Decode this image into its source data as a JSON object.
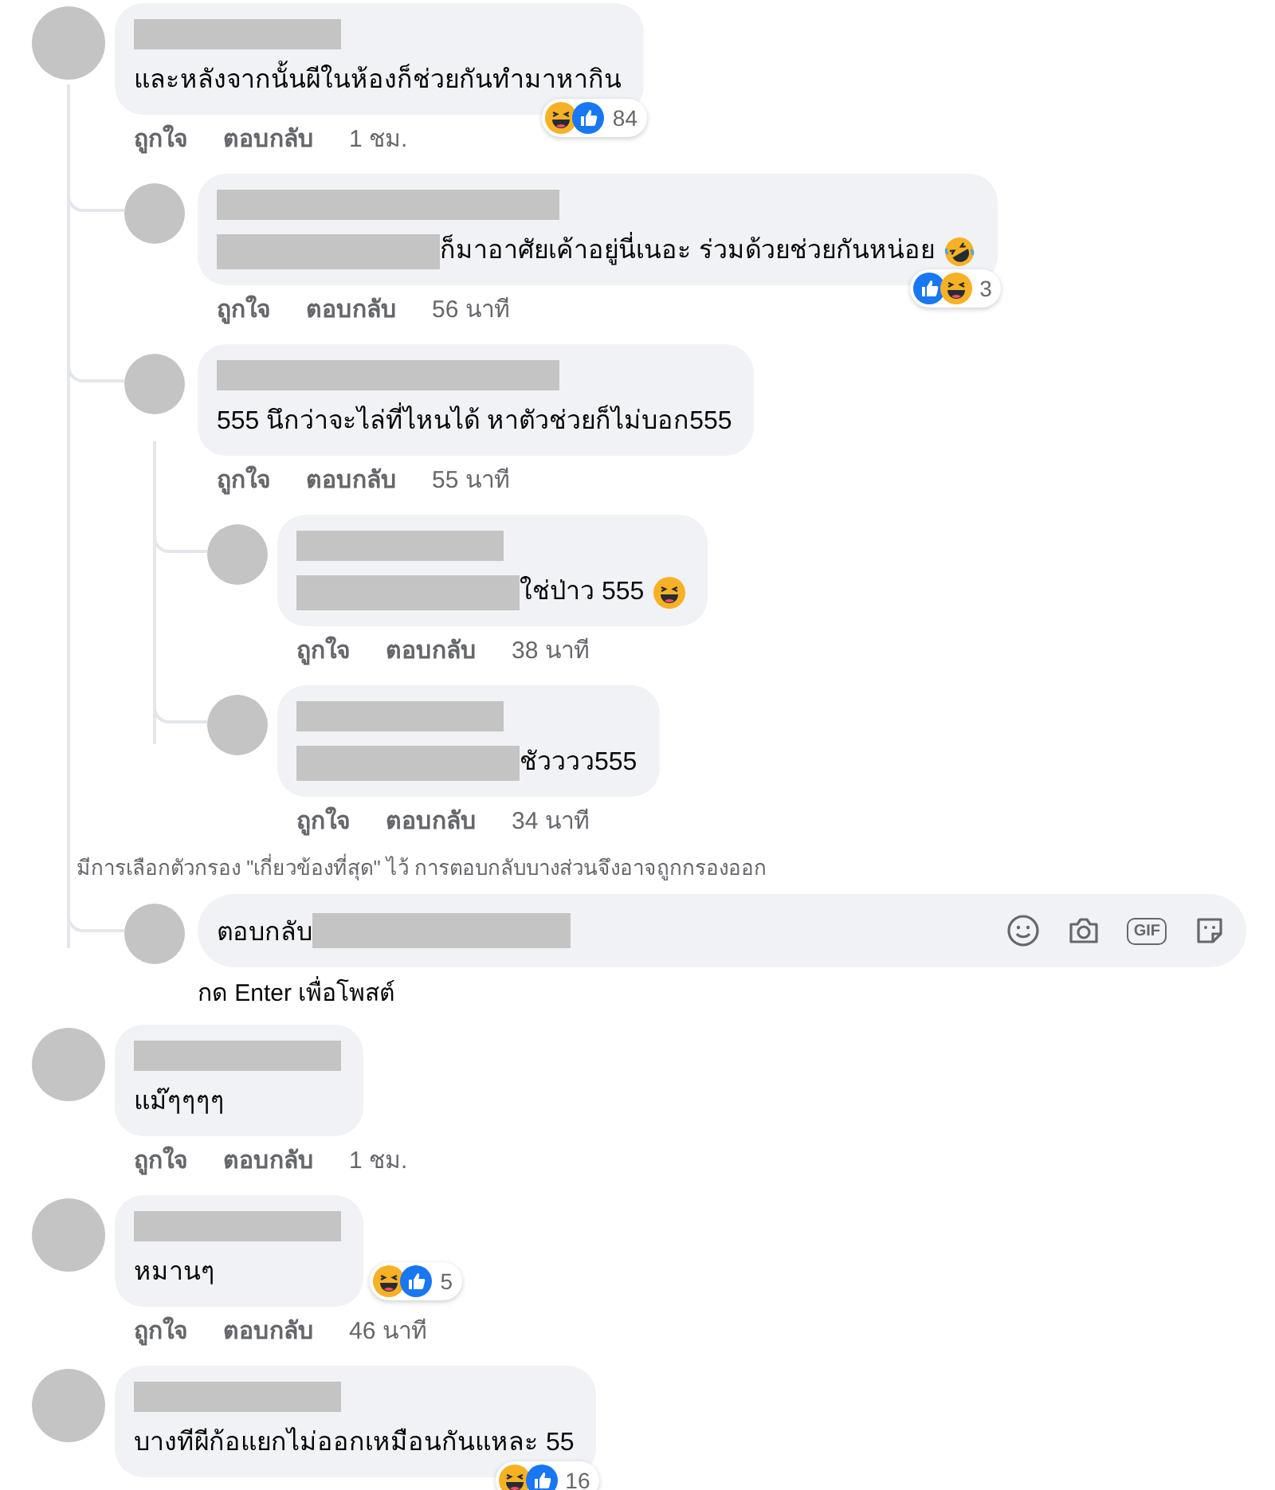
{
  "comments": [
    {
      "text": "และหลังจากนั้นผีในห้องก็ช่วยกันทำมาหากิน",
      "reactions": {
        "icons": [
          {
            "kind": "haha"
          },
          {
            "kind": "like"
          }
        ],
        "count": "84"
      },
      "like": "ถูกใจ",
      "reply": "ตอบกลับ",
      "time": "1 ชม.",
      "replies": [
        {
          "text": "ก็มาอาศัยเค้าอยู่นี่เนอะ ร่วมด้วยช่วยกันหน่อย",
          "mention": true,
          "emoji": {
            "kind": "rofl"
          },
          "reactions": {
            "icons": [
              {
                "kind": "like"
              },
              {
                "kind": "haha"
              }
            ],
            "count": "3"
          },
          "like": "ถูกใจ",
          "reply": "ตอบกลับ",
          "time": "56 นาที"
        },
        {
          "text": "555 นึกว่าจะไล่ที่ไหนได้ หาตัวช่วยก็ไม่บอก555",
          "like": "ถูกใจ",
          "reply": "ตอบกลับ",
          "time": "55 นาที",
          "replies": [
            {
              "text": "ใช่ป่าว 555",
              "mention": true,
              "emoji": {
                "kind": "haha"
              },
              "like": "ถูกใจ",
              "reply": "ตอบกลับ",
              "time": "38 นาที"
            },
            {
              "text": "ชัวววว555",
              "mention": true,
              "like": "ถูกใจ",
              "reply": "ตอบกลับ",
              "time": "34 นาที"
            }
          ]
        }
      ],
      "filter_note": "มีการเลือกตัวกรอง \"เกี่ยวข้องที่สุด\" ไว้ การตอบกลับบางส่วนจึงอาจถูกกรองออก",
      "reply_box": {
        "value": "ตอบกลับ",
        "gif_label": "GIF",
        "hint": "กด Enter เพื่อโพสต์"
      }
    },
    {
      "text": "แม๊ๆๆๆๆ",
      "like": "ถูกใจ",
      "reply": "ตอบกลับ",
      "time": "1 ชม."
    },
    {
      "text": "หมานๆ",
      "reactions": {
        "icons": [
          {
            "kind": "haha"
          },
          {
            "kind": "like"
          }
        ],
        "count": "5"
      },
      "like": "ถูกใจ",
      "reply": "ตอบกลับ",
      "time": "46 นาที"
    },
    {
      "text": "บางทีผีก้อแยกไม่ออกเหมือนกันแหละ 55",
      "reactions": {
        "icons": [
          {
            "kind": "haha"
          },
          {
            "kind": "like"
          }
        ],
        "count": "16"
      }
    }
  ]
}
